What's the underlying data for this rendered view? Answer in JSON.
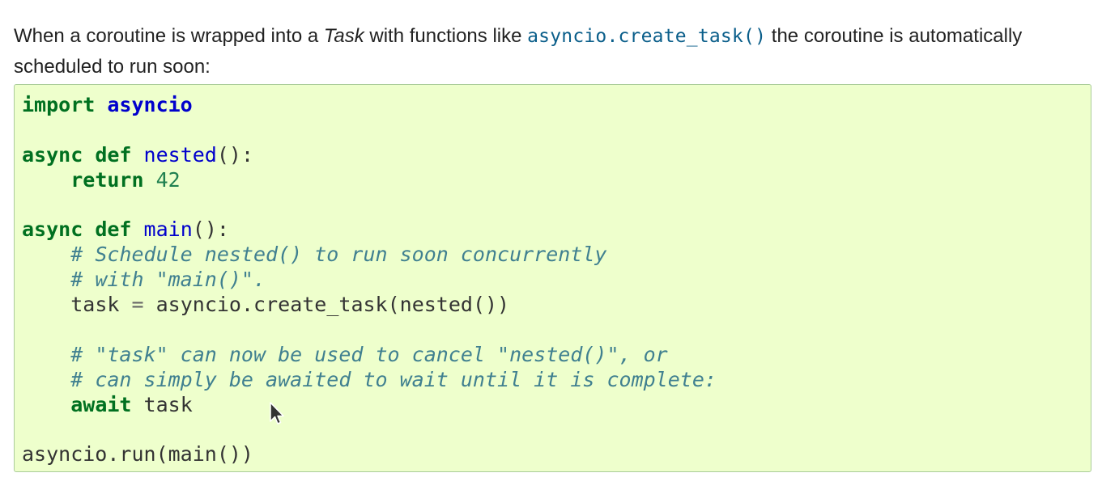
{
  "intro": {
    "text_before_task": "When a coroutine is wrapped into a ",
    "task_word": "Task",
    "text_after_task": " with functions like ",
    "function_link": "asyncio.create_task()",
    "text_after_link": " the coroutine is automatically scheduled to run soon:"
  },
  "code": {
    "line1": {
      "kw": "import",
      "module": "asyncio"
    },
    "line3": {
      "kw1": "async",
      "kw2": "def",
      "name": "nested",
      "rest": "():"
    },
    "line4": {
      "kw": "return",
      "number": "42"
    },
    "line6": {
      "kw1": "async",
      "kw2": "def",
      "name": "main",
      "rest": "():"
    },
    "line7": {
      "comment": "# Schedule nested() to run soon concurrently"
    },
    "line8": {
      "comment": "# with \"main()\"."
    },
    "line9": {
      "lhs": "task",
      "op": "=",
      "rhs": "asyncio.create_task(nested())"
    },
    "line11": {
      "comment": "# \"task\" can now be used to cancel \"nested()\", or"
    },
    "line12": {
      "comment": "# can simply be awaited to wait until it is complete:"
    },
    "line13": {
      "kw": "await",
      "name": "task"
    },
    "line15": {
      "text": "asyncio.run(main())"
    }
  },
  "colors": {
    "code_background": "#eeffcc",
    "keyword": "#007020",
    "function_name": "#0000cc",
    "comment": "#408090",
    "link": "#0a5e8a"
  },
  "icons": {
    "mouse_pointer": "mouse-pointer-icon"
  }
}
